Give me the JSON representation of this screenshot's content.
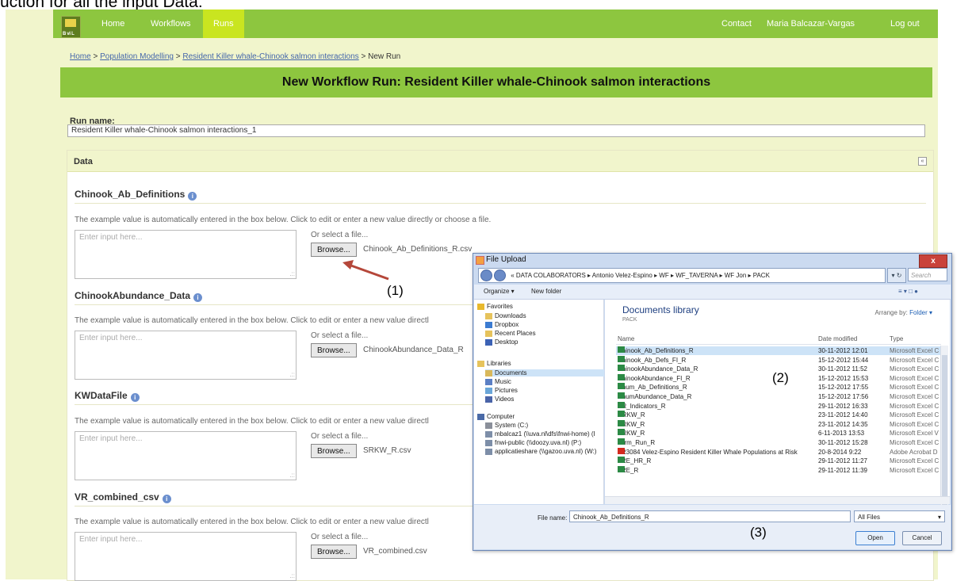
{
  "caption": "uction for all the input Data:",
  "nav": {
    "logo_text": "B vi L",
    "home": "Home",
    "workflows": "Workflows",
    "runs": "Runs",
    "contact": "Contact",
    "user": "Maria Balcazar-Vargas",
    "logout": "Log out"
  },
  "breadcrumb": {
    "home": "Home",
    "sep": ">",
    "pop": "Population Modelling",
    "wf": "Resident Killer whale-Chinook salmon interactions",
    "current": "New Run"
  },
  "page_title": "New Workflow Run: Resident Killer whale-Chinook salmon interactions",
  "run_name": {
    "label": "Run name:",
    "value": "Resident Killer whale-Chinook salmon interactions_1"
  },
  "data_panel": {
    "label": "Data",
    "collapse": "«"
  },
  "inputs": [
    {
      "title": "Chinook_Ab_Definitions",
      "hint": "The example value is automatically entered in the box below. Click to edit or enter a new value directly or choose a file.",
      "placeholder": "Enter input here...",
      "or_select": "Or select a file...",
      "browse": "Browse...",
      "file": "Chinook_Ab_Definitions_R.csv"
    },
    {
      "title": "ChinookAbundance_Data",
      "hint": "The example value is automatically entered in the box below. Click to edit or enter a new value directl",
      "placeholder": "Enter input here...",
      "or_select": "Or select a file...",
      "browse": "Browse...",
      "file": "ChinookAbundance_Data_R"
    },
    {
      "title": "KWDataFile",
      "hint": "The example value is automatically entered in the box below. Click to edit or enter a new value directl",
      "placeholder": "Enter input here...",
      "or_select": "Or select a file...",
      "browse": "Browse...",
      "file": "SRKW_R.csv"
    },
    {
      "title": "VR_combined_csv",
      "hint": "The example value is automatically entered in the box below. Click to edit or enter a new value directl",
      "placeholder": "Enter input here...",
      "or_select": "Or select a file...",
      "browse": "Browse...",
      "file": "VR_combined.csv"
    }
  ],
  "callouts": {
    "c1": "(1)",
    "c2": "(2)",
    "c3": "(3)"
  },
  "dialog": {
    "title": "File Upload",
    "close": "x",
    "path": "« DATA COLABORATORS ▸ Antonio Velez-Espino ▸ WF ▸ WF_TAVERNA ▸ WF Jon ▸ PACK",
    "refresh": "▾ ↻",
    "search_placeholder": "Search PACK",
    "organize": "Organize ▾",
    "new_folder": "New folder",
    "view_icons": "≡ ▾  □  ●",
    "nav": [
      {
        "label": "Favorites",
        "kind": "star"
      },
      {
        "label": "Downloads",
        "kind": "folder"
      },
      {
        "label": "Dropbox",
        "kind": "drop"
      },
      {
        "label": "Recent Places",
        "kind": "folder"
      },
      {
        "label": "Desktop",
        "kind": "desk"
      },
      {
        "label": "Libraries",
        "kind": "lib"
      },
      {
        "label": "Documents",
        "kind": "doc"
      },
      {
        "label": "Music",
        "kind": "music"
      },
      {
        "label": "Pictures",
        "kind": "pic"
      },
      {
        "label": "Videos",
        "kind": "vid"
      },
      {
        "label": "Computer",
        "kind": "comp"
      },
      {
        "label": "System (C:)",
        "kind": "drive"
      },
      {
        "label": "mbalcaz1 (\\\\uva.nl\\dfs\\fnwi-home) (I",
        "kind": "net"
      },
      {
        "label": "fnwi-public (\\\\doozy.uva.nl) (P:)",
        "kind": "net"
      },
      {
        "label": "applicatieshare (\\\\gazoo.uva.nl) (W:)",
        "kind": "net"
      }
    ],
    "library_title": "Documents library",
    "library_sub": "PACK",
    "arrange_label": "Arrange by:",
    "arrange_value": "Folder ▾",
    "columns": {
      "name": "Name",
      "date": "Date modified",
      "type": "Type"
    },
    "files": [
      {
        "name": "Chinook_Ab_Definitions_R",
        "date": "30-11-2012 12:01",
        "type": "Microsoft Excel C",
        "icon": "xl"
      },
      {
        "name": "Chinook_Ab_Defs_FI_R",
        "date": "15-12-2012 15:44",
        "type": "Microsoft Excel C",
        "icon": "xl"
      },
      {
        "name": "ChinookAbundance_Data_R",
        "date": "30-11-2012 11:52",
        "type": "Microsoft Excel C",
        "icon": "xl"
      },
      {
        "name": "ChinookAbundance_FI_R",
        "date": "15-12-2012 15:53",
        "type": "Microsoft Excel C",
        "icon": "xl"
      },
      {
        "name": "Chum_Ab_Definitions_R",
        "date": "15-12-2012 17:55",
        "type": "Microsoft Excel C",
        "icon": "xl"
      },
      {
        "name": "ChumAbundance_Data_R",
        "date": "15-12-2012 17:56",
        "type": "Microsoft Excel C",
        "icon": "xl"
      },
      {
        "name": "ER_Indicators_R",
        "date": "29-11-2012 16:33",
        "type": "Microsoft Excel C",
        "icon": "xl"
      },
      {
        "name": "NRKW_R",
        "date": "23-11-2012 14:40",
        "type": "Microsoft Excel C",
        "icon": "xl"
      },
      {
        "name": "SRKW_R",
        "date": "23-11-2012 14:35",
        "type": "Microsoft Excel C",
        "icon": "xl"
      },
      {
        "name": "SRKW_R",
        "date": "6-11-2013 13:53",
        "type": "Microsoft Excel V",
        "icon": "xl"
      },
      {
        "name": "Term_Run_R",
        "date": "30-11-2012 15:28",
        "type": "Microsoft Excel C",
        "icon": "xl"
      },
      {
        "name": "TR3084 Velez-Espino Resident Killer Whale Populations at Risk",
        "date": "20-8-2014 9:22",
        "type": "Adobe Acrobat D",
        "icon": "pdf"
      },
      {
        "name": "TRE_HR_R",
        "date": "29-11-2012 11:27",
        "type": "Microsoft Excel C",
        "icon": "xl"
      },
      {
        "name": "TRE_R",
        "date": "29-11-2012 11:39",
        "type": "Microsoft Excel C",
        "icon": "xl"
      }
    ],
    "filename_label": "File name:",
    "filename_value": "Chinook_Ab_Definitions_R",
    "filetype": "All Files",
    "open": "Open",
    "cancel": "Cancel"
  }
}
